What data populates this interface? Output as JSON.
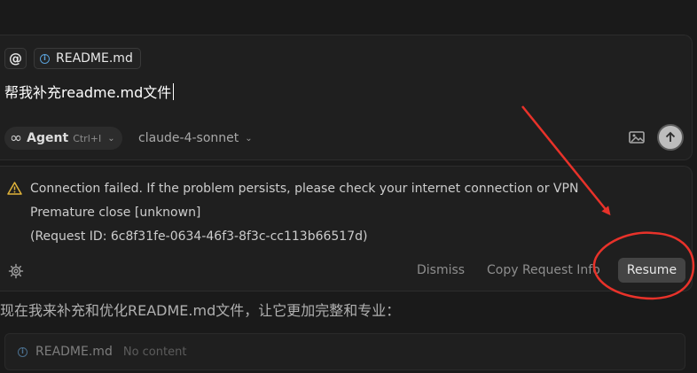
{
  "composer": {
    "at_symbol": "@",
    "context_chip": "README.md",
    "prompt_text": "帮我补充readme.md文件",
    "mode": {
      "label": "Agent",
      "shortcut": "Ctrl+I"
    },
    "model": "claude-4-sonnet"
  },
  "error": {
    "message": "Connection failed. If the problem persists, please check your internet connection or VPN",
    "detail": "Premature close [unknown]",
    "request_id": "(Request ID: 6c8f31fe-0634-46f3-8f3c-cc113b66517d)",
    "dismiss_label": "Dismiss",
    "copy_label": "Copy Request Info",
    "resume_label": "Resume"
  },
  "assistant": {
    "message": "现在我来补充和优化README.md文件，让它更加完整和专业：",
    "file_card": {
      "name": "README.md",
      "status": "No content"
    }
  },
  "colors": {
    "background": "#1a1a1a",
    "panel": "#1f1f1f",
    "annotation_red": "#e8322a",
    "warning": "#e0b33a"
  },
  "icons": {
    "mode": "infinity-icon",
    "image": "image-icon",
    "send": "arrow-up-icon",
    "warning": "warning-icon",
    "settings": "gear-icon",
    "context": "info-icon"
  }
}
